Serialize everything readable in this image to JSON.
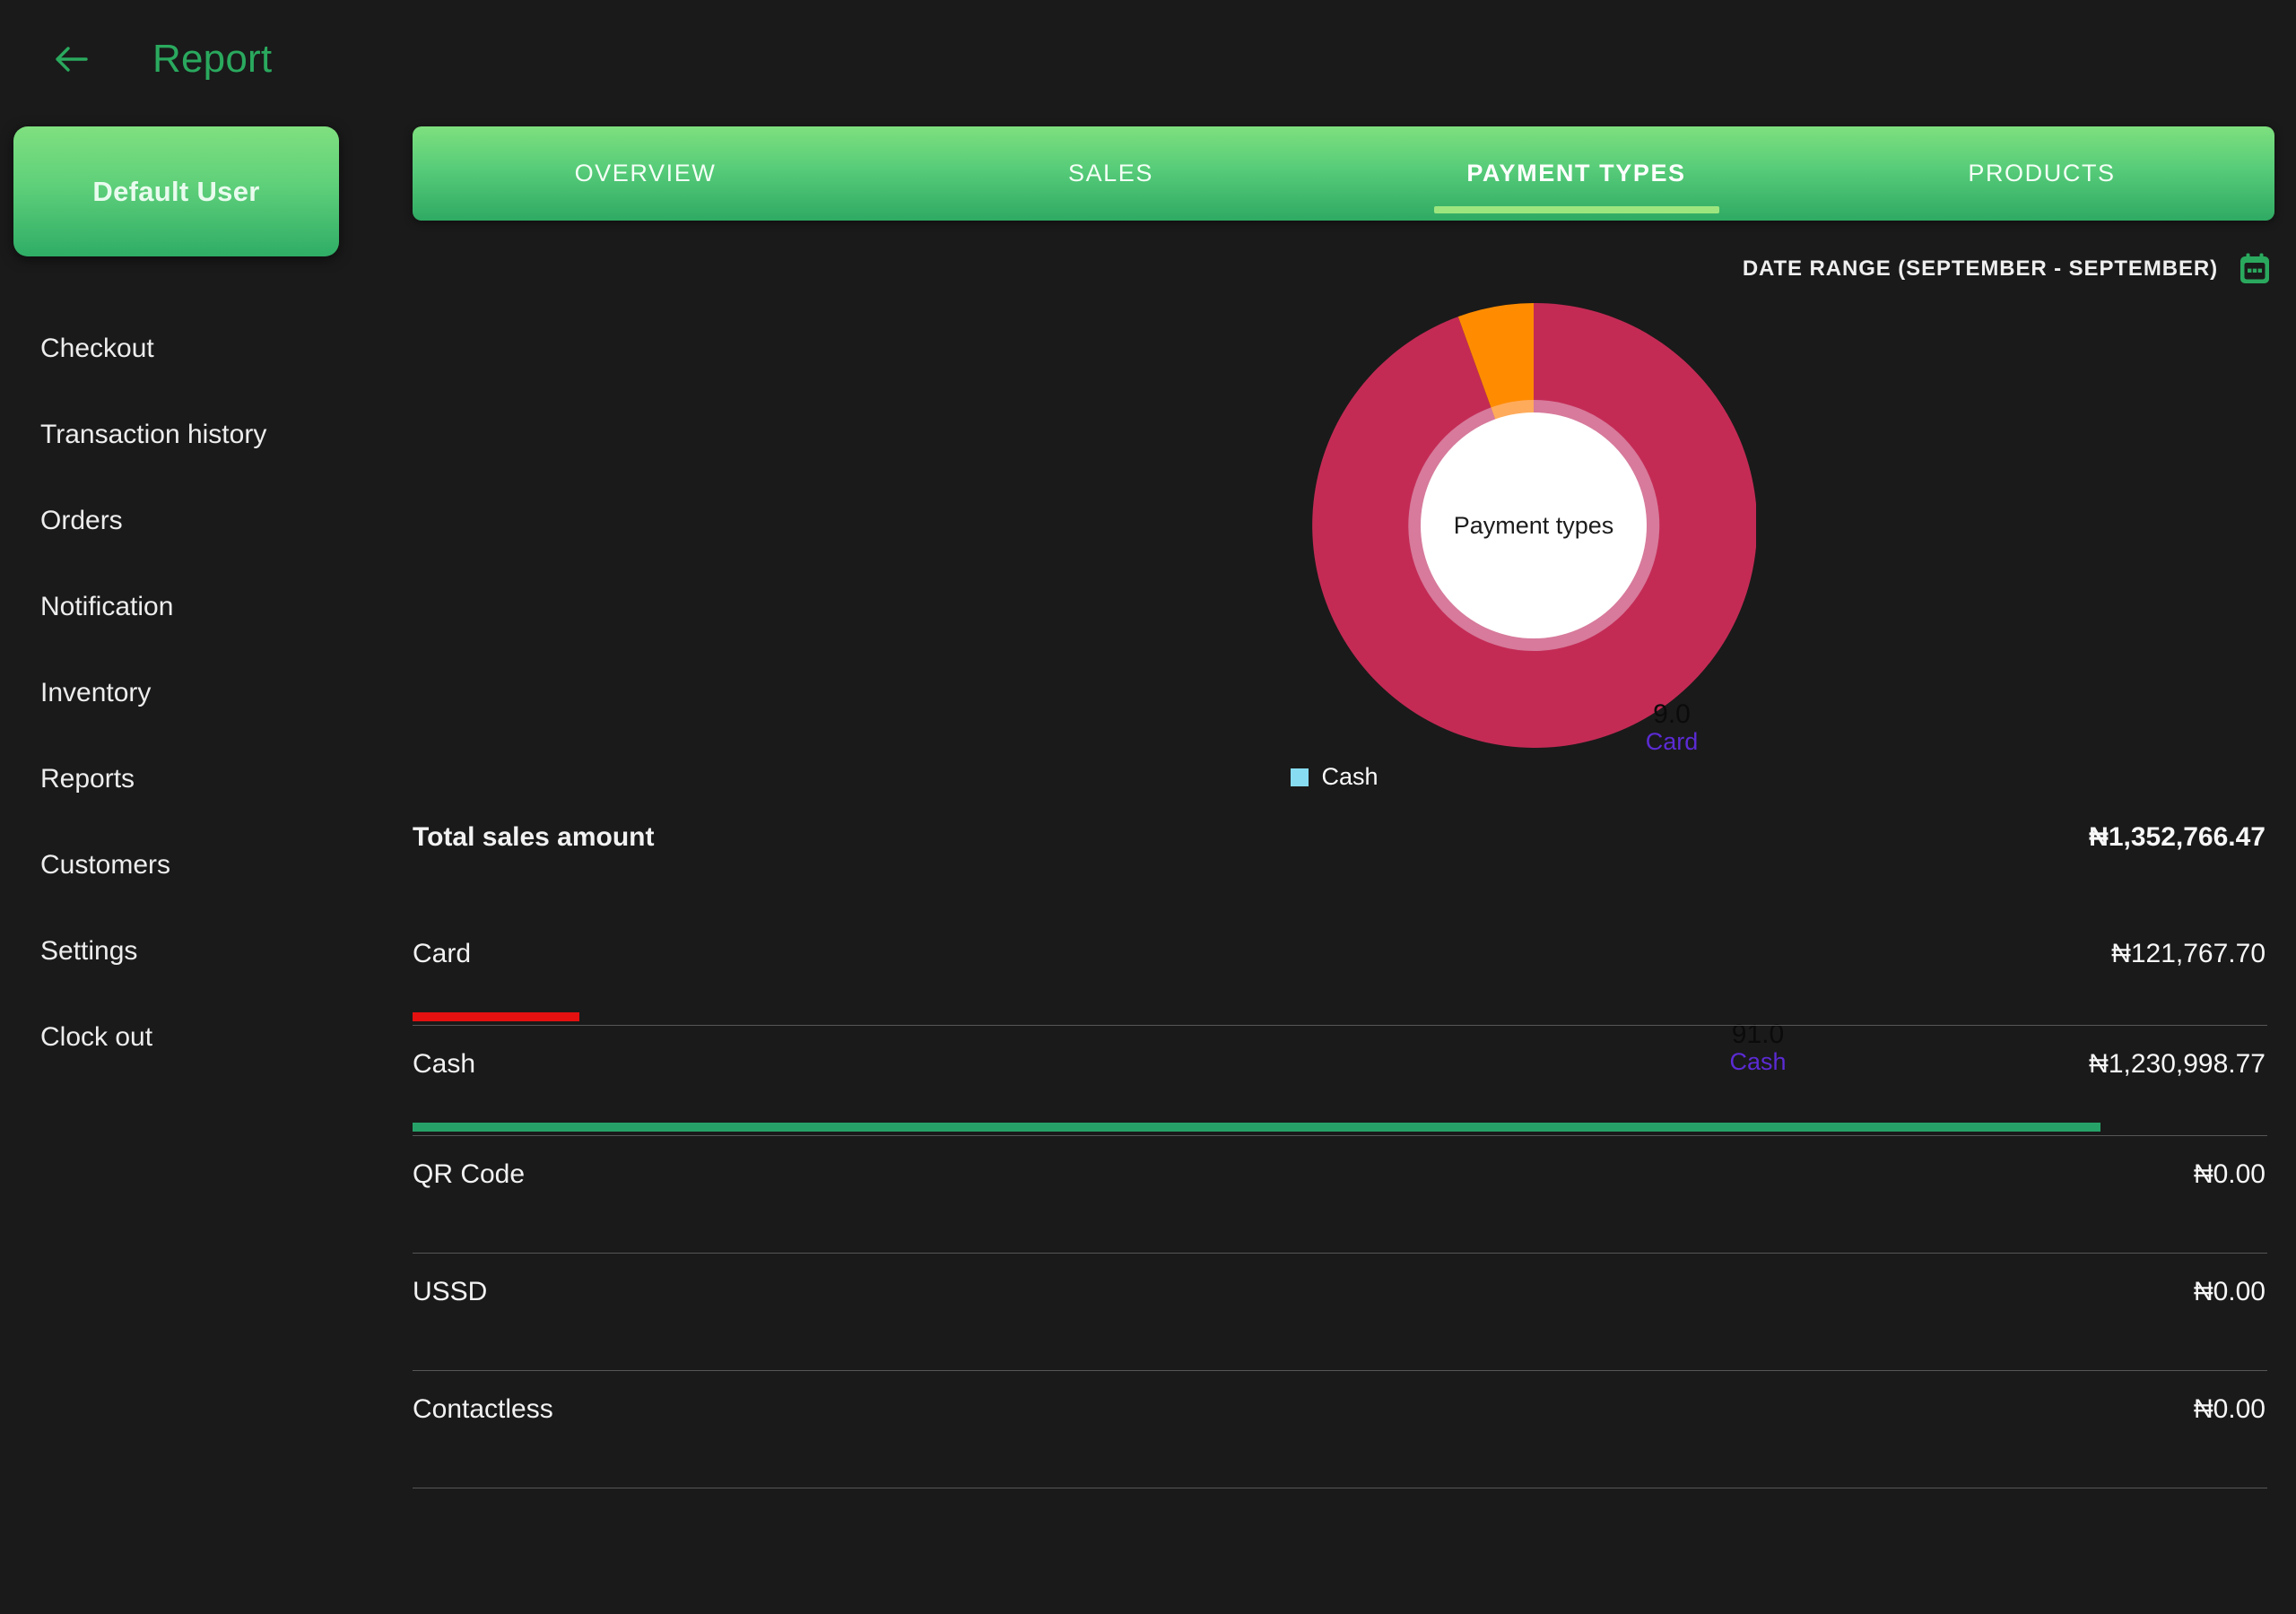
{
  "header": {
    "title": "Report",
    "back_icon": "arrow-left-icon",
    "title_color": "#2aa95e"
  },
  "sidebar": {
    "user_button": {
      "label": "Default User"
    },
    "items": [
      {
        "label": "Checkout"
      },
      {
        "label": "Transaction history"
      },
      {
        "label": "Orders"
      },
      {
        "label": "Notification"
      },
      {
        "label": "Inventory"
      },
      {
        "label": "Reports"
      },
      {
        "label": "Customers"
      },
      {
        "label": "Settings"
      },
      {
        "label": "Clock out"
      }
    ]
  },
  "tabs": [
    {
      "label": "OVERVIEW",
      "active": false
    },
    {
      "label": "SALES",
      "active": false
    },
    {
      "label": "PAYMENT TYPES",
      "active": true
    },
    {
      "label": "PRODUCTS",
      "active": false
    }
  ],
  "date_range": {
    "label": "DATE RANGE (SEPTEMBER - SEPTEMBER)",
    "icon": "calendar-icon",
    "icon_color": "#2aa95e"
  },
  "chart_data": {
    "type": "pie",
    "title": "Payment types",
    "center_label": "Payment types",
    "categories": [
      "Cash",
      "Card"
    ],
    "values": [
      91.0,
      9.0
    ],
    "value_labels": [
      "91.0",
      "9.0"
    ],
    "colors": [
      "#c32b55",
      "#ff8c00"
    ],
    "inner_ring_colors": [
      "#d77a9b",
      "#ffab5c"
    ],
    "label_name_color": "#5b2bd4",
    "label_value_color": "#0b0b0b",
    "donut_hole": true,
    "legend": {
      "position": "bottom",
      "entries": [
        {
          "label": "Cash",
          "color": "#87dcf2"
        }
      ]
    }
  },
  "payments_table": {
    "rows": [
      {
        "name": "Total sales amount",
        "value": "₦1,352,766.47",
        "bold": true,
        "bar_pct": 0,
        "bar_color": ""
      },
      {
        "name": "Card",
        "value": "₦121,767.70",
        "bold": false,
        "bar_pct": 9.0,
        "bar_color": "#e51010"
      },
      {
        "name": "Cash",
        "value": "₦1,230,998.77",
        "bold": false,
        "bar_pct": 91.0,
        "bar_color": "#26a269"
      },
      {
        "name": "QR Code",
        "value": "₦0.00",
        "bold": false,
        "bar_pct": 0,
        "bar_color": ""
      },
      {
        "name": "USSD",
        "value": "₦0.00",
        "bold": false,
        "bar_pct": 0,
        "bar_color": ""
      },
      {
        "name": "Contactless",
        "value": "₦0.00",
        "bold": false,
        "bar_pct": 0,
        "bar_color": ""
      }
    ]
  }
}
